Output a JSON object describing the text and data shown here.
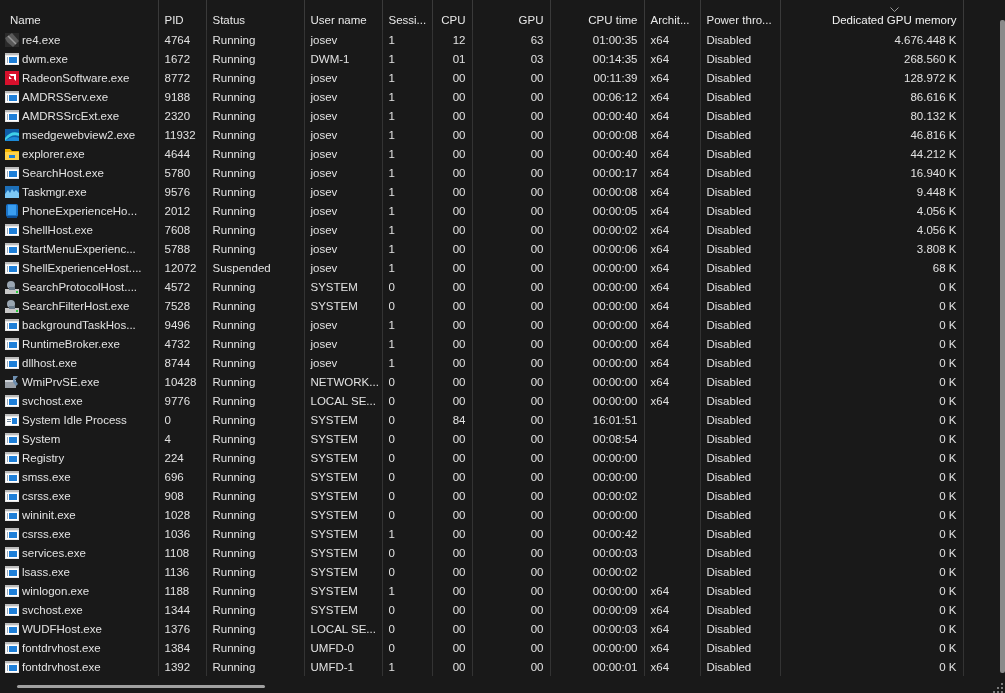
{
  "columns": [
    {
      "label": "Name",
      "sorted": false
    },
    {
      "label": "PID",
      "sorted": false
    },
    {
      "label": "Status",
      "sorted": false
    },
    {
      "label": "User name",
      "sorted": false
    },
    {
      "label": "Sessi...",
      "sorted": false
    },
    {
      "label": "CPU",
      "sorted": false
    },
    {
      "label": "GPU",
      "sorted": false
    },
    {
      "label": "CPU time",
      "sorted": false
    },
    {
      "label": "Archit...",
      "sorted": false
    },
    {
      "label": "Power thro...",
      "sorted": false
    },
    {
      "label": "Dedicated GPU memory",
      "sorted": true
    }
  ],
  "rows": [
    {
      "kind": "game",
      "cells": [
        "re4.exe",
        "4764",
        "Running",
        "josev",
        "1",
        "12",
        "63",
        "01:00:35",
        "x64",
        "Disabled",
        "4.676.448 K"
      ]
    },
    {
      "kind": "app",
      "cells": [
        "dwm.exe",
        "1672",
        "Running",
        "DWM-1",
        "1",
        "01",
        "03",
        "00:14:35",
        "x64",
        "Disabled",
        "268.560 K"
      ]
    },
    {
      "kind": "amd",
      "cells": [
        "RadeonSoftware.exe",
        "8772",
        "Running",
        "josev",
        "1",
        "00",
        "00",
        "00:11:39",
        "x64",
        "Disabled",
        "128.972 K"
      ]
    },
    {
      "kind": "app",
      "cells": [
        "AMDRSServ.exe",
        "9188",
        "Running",
        "josev",
        "1",
        "00",
        "00",
        "00:06:12",
        "x64",
        "Disabled",
        "86.616 K"
      ]
    },
    {
      "kind": "app",
      "cells": [
        "AMDRSSrcExt.exe",
        "2320",
        "Running",
        "josev",
        "1",
        "00",
        "00",
        "00:00:40",
        "x64",
        "Disabled",
        "80.132 K"
      ]
    },
    {
      "kind": "edge",
      "cells": [
        "msedgewebview2.exe",
        "11932",
        "Running",
        "josev",
        "1",
        "00",
        "00",
        "00:00:08",
        "x64",
        "Disabled",
        "46.816 K"
      ]
    },
    {
      "kind": "folder",
      "cells": [
        "explorer.exe",
        "4644",
        "Running",
        "josev",
        "1",
        "00",
        "00",
        "00:00:40",
        "x64",
        "Disabled",
        "44.212 K"
      ]
    },
    {
      "kind": "app",
      "cells": [
        "SearchHost.exe",
        "5780",
        "Running",
        "josev",
        "1",
        "00",
        "00",
        "00:00:17",
        "x64",
        "Disabled",
        "16.940 K"
      ]
    },
    {
      "kind": "taskmgr",
      "cells": [
        "Taskmgr.exe",
        "9576",
        "Running",
        "josev",
        "1",
        "00",
        "00",
        "00:00:08",
        "x64",
        "Disabled",
        "9.448 K"
      ]
    },
    {
      "kind": "phone",
      "cells": [
        "PhoneExperienceHo...",
        "2012",
        "Running",
        "josev",
        "1",
        "00",
        "00",
        "00:00:05",
        "x64",
        "Disabled",
        "4.056 K"
      ]
    },
    {
      "kind": "app",
      "cells": [
        "ShellHost.exe",
        "7608",
        "Running",
        "josev",
        "1",
        "00",
        "00",
        "00:00:02",
        "x64",
        "Disabled",
        "4.056 K"
      ]
    },
    {
      "kind": "app",
      "cells": [
        "StartMenuExperienc...",
        "5788",
        "Running",
        "josev",
        "1",
        "00",
        "00",
        "00:00:06",
        "x64",
        "Disabled",
        "3.808 K"
      ]
    },
    {
      "kind": "app",
      "cells": [
        "ShellExperienceHost....",
        "12072",
        "Suspended",
        "josev",
        "1",
        "00",
        "00",
        "00:00:00",
        "x64",
        "Disabled",
        "68 K"
      ]
    },
    {
      "kind": "service",
      "cells": [
        "SearchProtocolHost....",
        "4572",
        "Running",
        "SYSTEM",
        "0",
        "00",
        "00",
        "00:00:00",
        "x64",
        "Disabled",
        "0 K"
      ]
    },
    {
      "kind": "service",
      "cells": [
        "SearchFilterHost.exe",
        "7528",
        "Running",
        "SYSTEM",
        "0",
        "00",
        "00",
        "00:00:00",
        "x64",
        "Disabled",
        "0 K"
      ]
    },
    {
      "kind": "app",
      "cells": [
        "backgroundTaskHos...",
        "9496",
        "Running",
        "josev",
        "1",
        "00",
        "00",
        "00:00:00",
        "x64",
        "Disabled",
        "0 K"
      ]
    },
    {
      "kind": "app",
      "cells": [
        "RuntimeBroker.exe",
        "4732",
        "Running",
        "josev",
        "1",
        "00",
        "00",
        "00:00:00",
        "x64",
        "Disabled",
        "0 K"
      ]
    },
    {
      "kind": "app",
      "cells": [
        "dllhost.exe",
        "8744",
        "Running",
        "josev",
        "1",
        "00",
        "00",
        "00:00:00",
        "x64",
        "Disabled",
        "0 K"
      ]
    },
    {
      "kind": "wmi",
      "cells": [
        "WmiPrvSE.exe",
        "10428",
        "Running",
        "NETWORK...",
        "0",
        "00",
        "00",
        "00:00:00",
        "x64",
        "Disabled",
        "0 K"
      ]
    },
    {
      "kind": "app",
      "cells": [
        "svchost.exe",
        "9776",
        "Running",
        "LOCAL SE...",
        "0",
        "00",
        "00",
        "00:00:00",
        "x64",
        "Disabled",
        "0 K"
      ]
    },
    {
      "kind": "idle",
      "cells": [
        "System Idle Process",
        "0",
        "Running",
        "SYSTEM",
        "0",
        "84",
        "00",
        "16:01:51",
        null,
        "Disabled",
        "0 K"
      ]
    },
    {
      "kind": "app",
      "cells": [
        "System",
        "4",
        "Running",
        "SYSTEM",
        "0",
        "00",
        "00",
        "00:08:54",
        null,
        "Disabled",
        "0 K"
      ]
    },
    {
      "kind": "app",
      "cells": [
        "Registry",
        "224",
        "Running",
        "SYSTEM",
        "0",
        "00",
        "00",
        "00:00:00",
        null,
        "Disabled",
        "0 K"
      ]
    },
    {
      "kind": "app",
      "cells": [
        "smss.exe",
        "696",
        "Running",
        "SYSTEM",
        "0",
        "00",
        "00",
        "00:00:00",
        null,
        "Disabled",
        "0 K"
      ]
    },
    {
      "kind": "app",
      "cells": [
        "csrss.exe",
        "908",
        "Running",
        "SYSTEM",
        "0",
        "00",
        "00",
        "00:00:02",
        null,
        "Disabled",
        "0 K"
      ]
    },
    {
      "kind": "app",
      "cells": [
        "wininit.exe",
        "1028",
        "Running",
        "SYSTEM",
        "0",
        "00",
        "00",
        "00:00:00",
        null,
        "Disabled",
        "0 K"
      ]
    },
    {
      "kind": "app",
      "cells": [
        "csrss.exe",
        "1036",
        "Running",
        "SYSTEM",
        "1",
        "00",
        "00",
        "00:00:42",
        null,
        "Disabled",
        "0 K"
      ]
    },
    {
      "kind": "app",
      "cells": [
        "services.exe",
        "1108",
        "Running",
        "SYSTEM",
        "0",
        "00",
        "00",
        "00:00:03",
        null,
        "Disabled",
        "0 K"
      ]
    },
    {
      "kind": "app",
      "cells": [
        "lsass.exe",
        "1136",
        "Running",
        "SYSTEM",
        "0",
        "00",
        "00",
        "00:00:02",
        null,
        "Disabled",
        "0 K"
      ]
    },
    {
      "kind": "app",
      "cells": [
        "winlogon.exe",
        "1188",
        "Running",
        "SYSTEM",
        "1",
        "00",
        "00",
        "00:00:00",
        "x64",
        "Disabled",
        "0 K"
      ]
    },
    {
      "kind": "app",
      "cells": [
        "svchost.exe",
        "1344",
        "Running",
        "SYSTEM",
        "0",
        "00",
        "00",
        "00:00:09",
        "x64",
        "Disabled",
        "0 K"
      ]
    },
    {
      "kind": "app",
      "cells": [
        "WUDFHost.exe",
        "1376",
        "Running",
        "LOCAL SE...",
        "0",
        "00",
        "00",
        "00:00:03",
        "x64",
        "Disabled",
        "0 K"
      ]
    },
    {
      "kind": "app",
      "cells": [
        "fontdrvhost.exe",
        "1384",
        "Running",
        "UMFD-0",
        "0",
        "00",
        "00",
        "00:00:00",
        "x64",
        "Disabled",
        "0 K"
      ]
    },
    {
      "kind": "app",
      "cells": [
        "fontdrvhost.exe",
        "1392",
        "Running",
        "UMFD-1",
        "1",
        "00",
        "00",
        "00:00:01",
        "x64",
        "Disabled",
        "0 K"
      ]
    }
  ]
}
